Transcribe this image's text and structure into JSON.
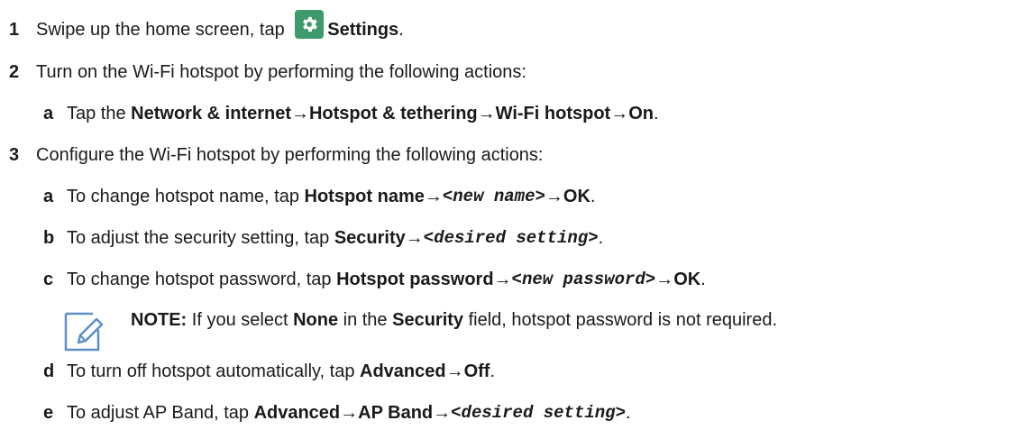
{
  "steps": [
    {
      "num": "1",
      "pre": "Swipe up the home screen, tap ",
      "icon": "settings-gear-icon",
      "bold": "Settings",
      "post": "."
    },
    {
      "num": "2",
      "text": "Turn on the Wi-Fi hotspot by performing the following actions:",
      "sub": [
        {
          "letter": "a",
          "pre": "Tap the ",
          "path": [
            "Network & internet",
            "Hotspot & tethering",
            "Wi-Fi hotspot",
            "On"
          ],
          "post": "."
        }
      ]
    },
    {
      "num": "3",
      "text": "Configure the Wi-Fi hotspot by performing the following actions:",
      "sub": [
        {
          "letter": "a",
          "pre": "To change hotspot name, tap ",
          "b1": "Hotspot name",
          "m1": "<new name>",
          "b2": "OK",
          "post": "."
        },
        {
          "letter": "b",
          "pre": "To adjust the security setting, tap ",
          "b1": "Security",
          "m1": "<desired setting>",
          "post": "."
        },
        {
          "letter": "c",
          "pre": "To change hotspot password, tap ",
          "b1": "Hotspot password",
          "m1": "<new password>",
          "b2": "OK",
          "post": "."
        },
        {
          "letter": "d",
          "pre": "To turn off hotspot automatically, tap ",
          "b1": "Advanced",
          "b2": "Off",
          "post": "."
        },
        {
          "letter": "e",
          "pre": "To adjust AP Band, tap ",
          "b1": "Advanced",
          "b2": "AP Band",
          "m1": "<desired setting>",
          "post": "."
        }
      ]
    }
  ],
  "note": {
    "icon": "note-pencil-icon",
    "label": "NOTE:",
    "t1": " If you select ",
    "b1": "None",
    "t2": " in the ",
    "b2": "Security",
    "t3": " field, hotspot password is not required."
  },
  "arrow": "→",
  "colors": {
    "gear_bg": "#3e9a6a",
    "note_icon": "#5b8fc7",
    "text": "#1a1a1a"
  }
}
